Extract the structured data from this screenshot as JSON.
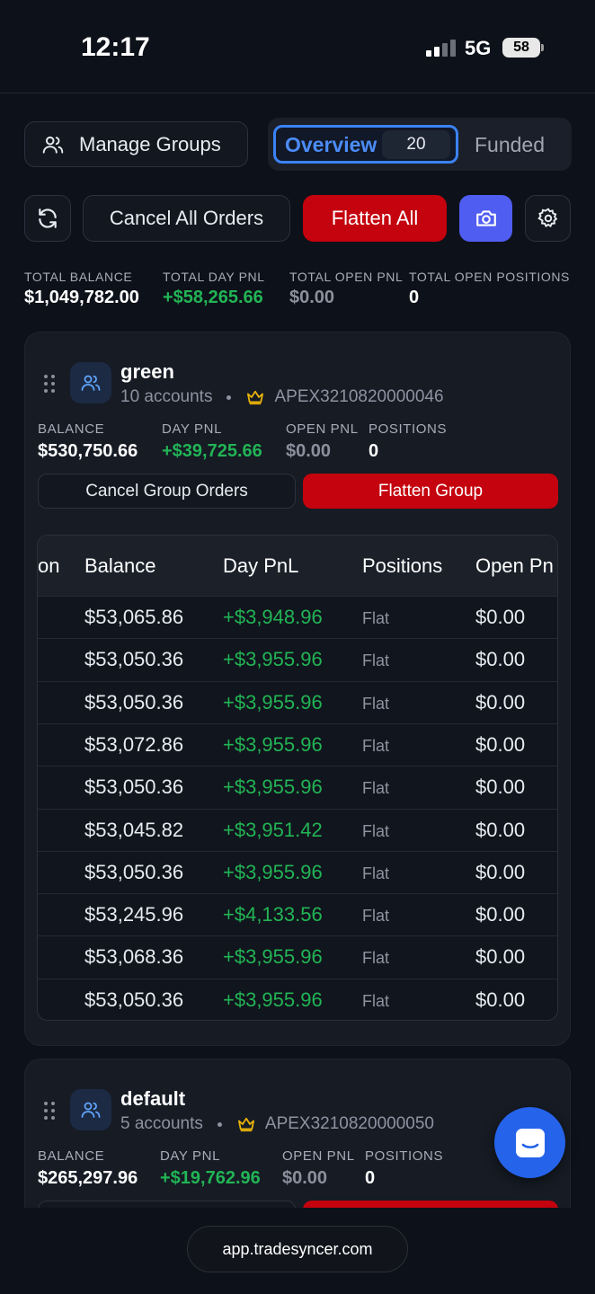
{
  "status_bar": {
    "time": "12:17",
    "network": "5G",
    "battery": "58"
  },
  "toolbar": {
    "manage_groups": "Manage Groups",
    "tab_overview": "Overview",
    "tab_overview_count": "20",
    "tab_funded": "Funded",
    "cancel_all": "Cancel All Orders",
    "flatten_all": "Flatten All"
  },
  "totals": {
    "balance_label": "TOTAL BALANCE",
    "balance": "$1,049,782.00",
    "day_pnl_label": "TOTAL DAY PNL",
    "day_pnl": "+$58,265.66",
    "open_pnl_label": "TOTAL OPEN PNL",
    "open_pnl": "$0.00",
    "positions_label": "TOTAL OPEN POSITIONS",
    "positions": "0"
  },
  "groups": [
    {
      "name": "green",
      "accounts": "10 accounts",
      "leader": "APEX3210820000046",
      "balance_label": "BALANCE",
      "balance": "$530,750.66",
      "day_pnl_label": "DAY PNL",
      "day_pnl": "+$39,725.66",
      "open_pnl_label": "OPEN PNL",
      "open_pnl": "$0.00",
      "positions_label": "POSITIONS",
      "positions": "0",
      "cancel_label": "Cancel Group Orders",
      "flatten_label": "Flatten Group"
    },
    {
      "name": "default",
      "accounts": "5 accounts",
      "leader": "APEX3210820000050",
      "balance_label": "BALANCE",
      "balance": "$265,297.96",
      "day_pnl_label": "DAY PNL",
      "day_pnl": "+$19,762.96",
      "open_pnl_label": "OPEN PNL",
      "open_pnl": "$0.00",
      "positions_label": "POSITIONS",
      "positions": "0"
    }
  ],
  "table": {
    "headers": [
      "on",
      "Balance",
      "Day PnL",
      "Positions",
      "Open Pn"
    ],
    "rows": [
      [
        "$53,065.86",
        "+$3,948.96",
        "Flat",
        "$0.00"
      ],
      [
        "$53,050.36",
        "+$3,955.96",
        "Flat",
        "$0.00"
      ],
      [
        "$53,050.36",
        "+$3,955.96",
        "Flat",
        "$0.00"
      ],
      [
        "$53,072.86",
        "+$3,955.96",
        "Flat",
        "$0.00"
      ],
      [
        "$53,050.36",
        "+$3,955.96",
        "Flat",
        "$0.00"
      ],
      [
        "$53,045.82",
        "+$3,951.42",
        "Flat",
        "$0.00"
      ],
      [
        "$53,050.36",
        "+$3,955.96",
        "Flat",
        "$0.00"
      ],
      [
        "$53,245.96",
        "+$4,133.56",
        "Flat",
        "$0.00"
      ],
      [
        "$53,068.36",
        "+$3,955.96",
        "Flat",
        "$0.00"
      ],
      [
        "$53,050.36",
        "+$3,955.96",
        "Flat",
        "$0.00"
      ]
    ]
  },
  "browser": {
    "url": "app.tradesyncer.com"
  }
}
